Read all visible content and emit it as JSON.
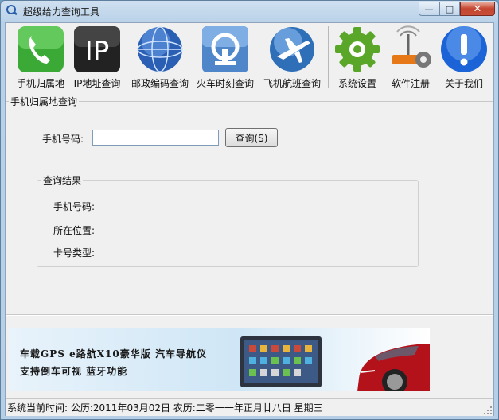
{
  "window": {
    "title": "超级给力查询工具"
  },
  "toolbar": {
    "items": [
      {
        "label": "手机归属地",
        "icon": "phone-icon"
      },
      {
        "label": "IP地址查询",
        "icon": "ip-icon"
      },
      {
        "label": "邮政编码查询",
        "icon": "globe-icon"
      },
      {
        "label": "火车时刻查询",
        "icon": "train-icon"
      },
      {
        "label": "飞机航班查询",
        "icon": "airplane-icon"
      },
      {
        "label": "系统设置",
        "icon": "gear-icon"
      },
      {
        "label": "软件注册",
        "icon": "router-gear-icon"
      },
      {
        "label": "关于我们",
        "icon": "info-icon"
      }
    ],
    "ip_text": "IP"
  },
  "query": {
    "group_title": "手机归属地查询",
    "phone_label": "手机号码:",
    "phone_value": "",
    "button_label": "查询(S)"
  },
  "result": {
    "group_title": "查询结果",
    "phone_label": "手机号码:",
    "location_label": "所在位置:",
    "card_type_label": "卡号类型:"
  },
  "banner": {
    "line1": "车载GPS e路航X10豪华版 汽车导航仪",
    "line2": "支持倒车可视 蓝牙功能"
  },
  "status": {
    "text": "系统当前时间:  公历:2011年03月02日  农历:二零一一年正月廿八日  星期三"
  },
  "colors": {
    "phone": "#3aa935",
    "ip": "#222222",
    "globe": "#2b5fb3",
    "train": "#4f86c9",
    "airplane": "#2e6fb8",
    "gear": "#5aa629",
    "router": "#e67817",
    "info": "#1b63d6"
  }
}
